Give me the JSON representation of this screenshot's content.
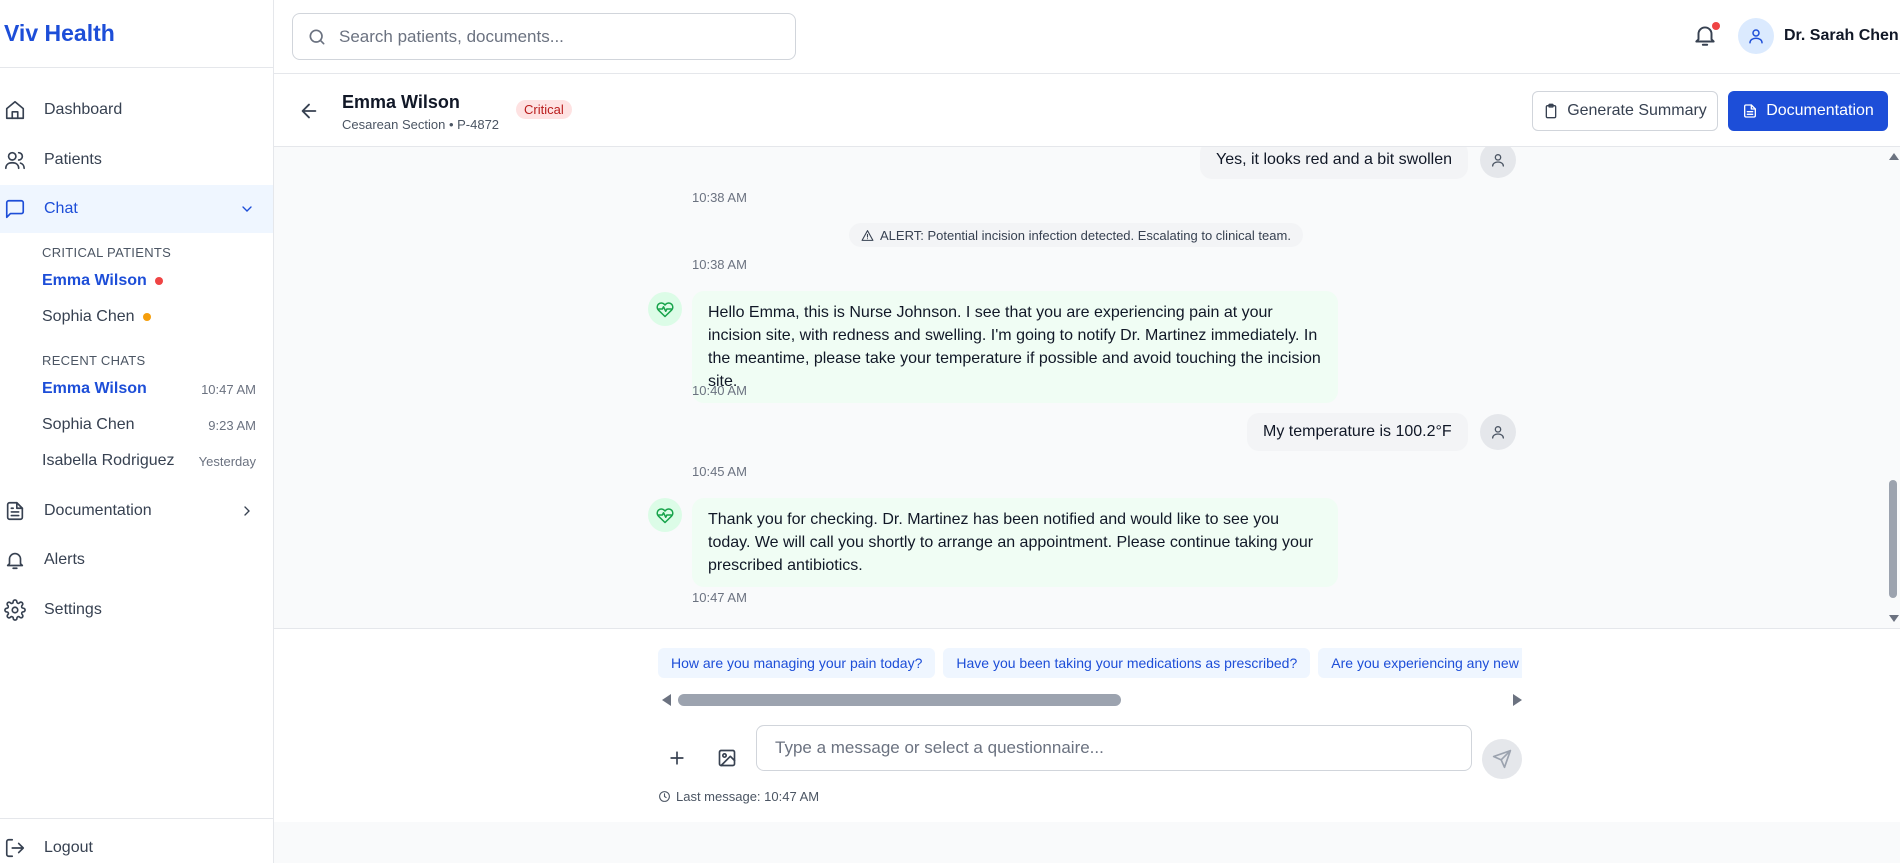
{
  "app": {
    "brand": "Viv Health"
  },
  "colors": {
    "brand": "#1d4ed8",
    "critical": "#ef4444",
    "warning": "#f59e0b",
    "nurse_bubble": "#f0fdf4"
  },
  "sidebar": {
    "nav": [
      {
        "label": "Dashboard",
        "icon": "home-icon"
      },
      {
        "label": "Patients",
        "icon": "users-icon"
      },
      {
        "label": "Chat",
        "icon": "message-square-icon",
        "active": true,
        "expanded": true
      },
      {
        "label": "Documentation",
        "icon": "file-text-icon"
      },
      {
        "label": "Alerts",
        "icon": "bell-icon"
      },
      {
        "label": "Settings",
        "icon": "gear-icon"
      }
    ],
    "critical_heading": "CRITICAL PATIENTS",
    "critical": [
      {
        "name": "Emma Wilson",
        "status": "critical",
        "active": true
      },
      {
        "name": "Sophia Chen",
        "status": "warning"
      }
    ],
    "recent_heading": "RECENT CHATS",
    "recent": [
      {
        "name": "Emma Wilson",
        "time": "10:47 AM",
        "active": true
      },
      {
        "name": "Sophia Chen",
        "time": "9:23 AM"
      },
      {
        "name": "Isabella Rodriguez",
        "time": "Yesterday"
      }
    ],
    "logout": "Logout"
  },
  "topbar": {
    "search_placeholder": "Search patients, documents...",
    "user_name": "Dr. Sarah Chen",
    "has_notification": true
  },
  "patient": {
    "name": "Emma Wilson",
    "subtitle": "Cesarean Section • P-4872",
    "badge": "Critical",
    "btn_summary": "Generate Summary",
    "btn_documentation": "Documentation"
  },
  "messages": {
    "m1_text": "Yes, it looks red and a bit swollen",
    "m1_time": "10:38 AM",
    "alert_text": "ALERT: Potential incision infection detected. Escalating to clinical team.",
    "alert_time": "10:38 AM",
    "m2_text": "Hello Emma, this is Nurse Johnson. I see that you are experiencing pain at your incision site, with redness and swelling. I'm going to notify Dr. Martinez immediately. In the meantime, please take your temperature if possible and avoid touching the incision site.",
    "m2_time": "10:40 AM",
    "m3_text": "My temperature is 100.2°F",
    "m3_time": "10:45 AM",
    "m4_text": "Thank you for checking. Dr. Martinez has been notified and would like to see you today. We will call you shortly to arrange an appointment. Please continue taking your prescribed antibiotics.",
    "m4_time": "10:47 AM"
  },
  "composer": {
    "questions": [
      "How are you managing your pain today?",
      "Have you been taking your medications as prescribed?",
      "Are you experiencing any new symptoms?"
    ],
    "placeholder": "Type a message or select a questionnaire...",
    "last_message": "Last message: 10:47 AM"
  }
}
